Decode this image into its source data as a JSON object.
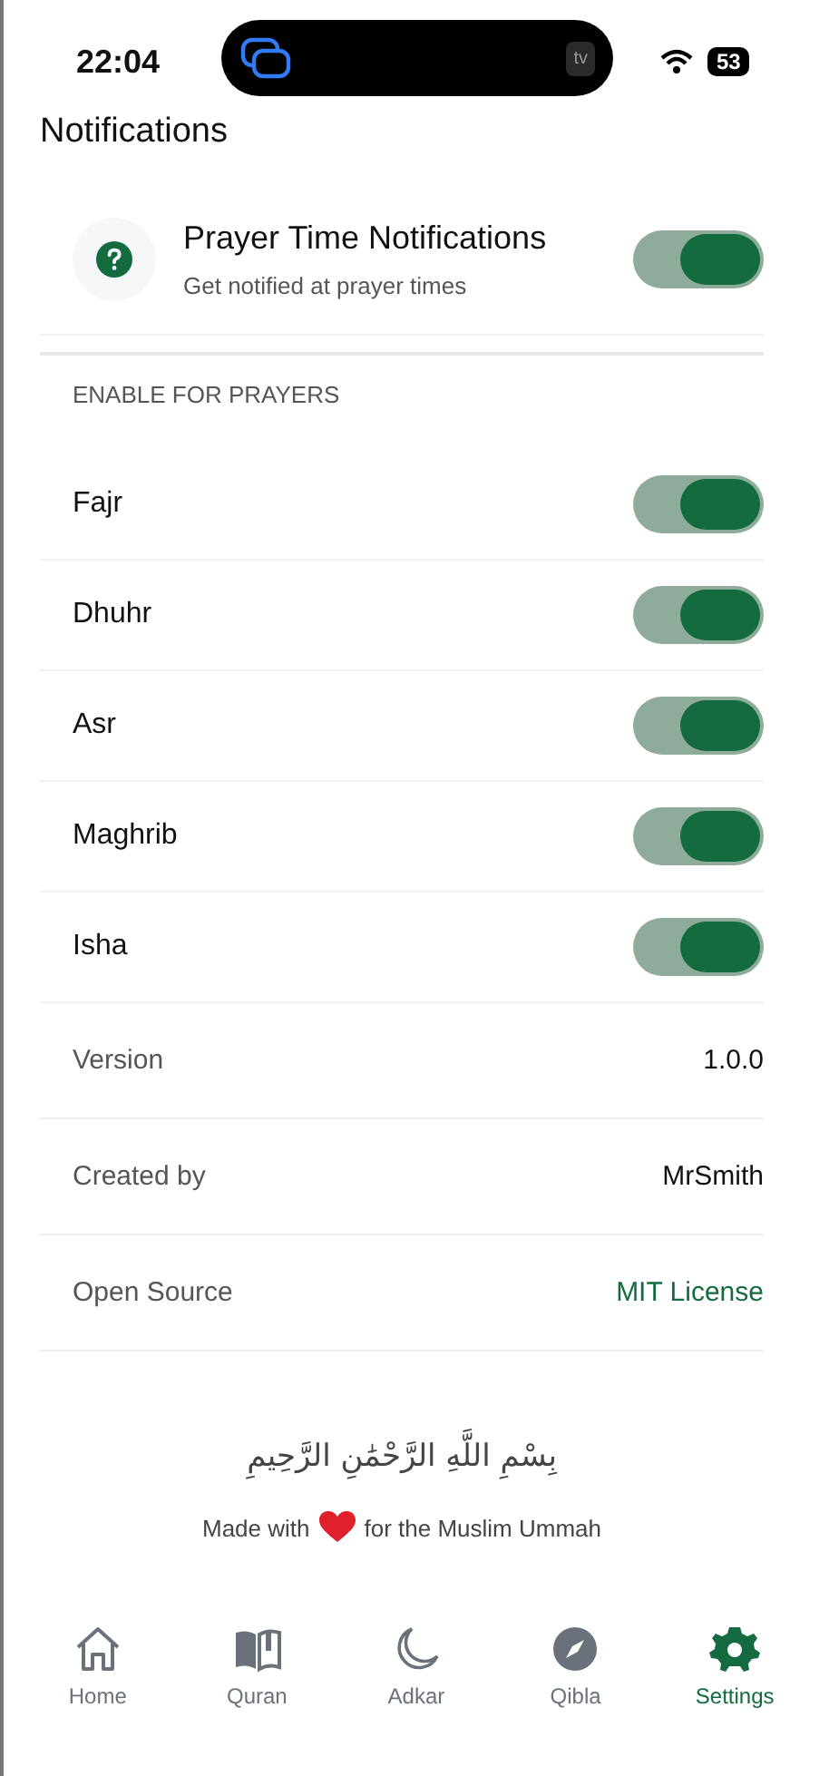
{
  "status_bar": {
    "time": "22:04",
    "live_activity_label": "tv",
    "battery": "53"
  },
  "section_title": "Notifications",
  "main_toggle": {
    "title": "Prayer Time Notifications",
    "subtitle": "Get notified at prayer times",
    "on": true
  },
  "prayers_header": "ENABLE FOR PRAYERS",
  "prayers": [
    {
      "name": "Fajr",
      "on": true
    },
    {
      "name": "Dhuhr",
      "on": true
    },
    {
      "name": "Asr",
      "on": true
    },
    {
      "name": "Maghrib",
      "on": true
    },
    {
      "name": "Isha",
      "on": true
    }
  ],
  "info_rows": [
    {
      "label": "Version",
      "value": "1.0.0",
      "kind": "text"
    },
    {
      "label": "Created by",
      "value": "MrSmith",
      "kind": "text"
    },
    {
      "label": "Open Source",
      "value": "MIT License",
      "kind": "link"
    }
  ],
  "footer": {
    "bismillah": "بِسْمِ اللَّهِ الرَّحْمَٰنِ الرَّحِيمِ",
    "made_with": "Made with",
    "made_for": "for the Muslim Ummah"
  },
  "tabs": [
    {
      "label": "Home",
      "kind": "home",
      "selected": false
    },
    {
      "label": "Quran",
      "kind": "book",
      "selected": false
    },
    {
      "label": "Adkar",
      "kind": "moon",
      "selected": false
    },
    {
      "label": "Qibla",
      "kind": "compass",
      "selected": false
    },
    {
      "label": "Settings",
      "kind": "gear",
      "selected": true
    }
  ]
}
